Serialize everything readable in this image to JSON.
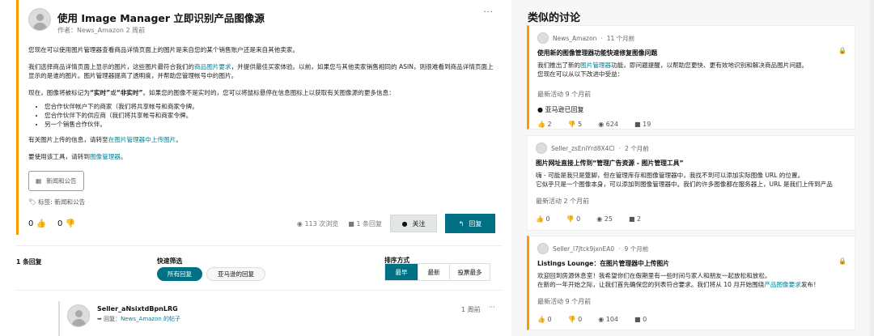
{
  "post": {
    "title": "使用 Image Manager 立即识别产品图像源",
    "meta": "作者：News_Amazon 2 周前",
    "more": "···",
    "p1": "您现在可以使用图片管理器查看商品详情页面上的图片是来自您的某个销售账户还是来自其他卖家。",
    "p2a": "我们选择商品详情页面上显示的图片，这些图片最符合我们的",
    "p2link": "商品图片要求",
    "p2b": "，并提供最佳买家体验。以前，如果您与其他卖家销售相同的 ASIN，则很难看到商品详情页面上显示的是谁的图片。图片管理器提高了透明度，并帮助您管理帐号中的图片。",
    "p3a": "现在，图像将被标记为",
    "p3b1": "“实时”",
    "p3c": "或",
    "p3b2": "“非实时”",
    "p3d": "。如果您的图像不是实时的，您可以将鼠标悬停在信息图标上以获取有关图像源的更多信息：",
    "bullets": [
      "您合作伙伴帐户下的商家（我们将共享帐号和商家令牌。",
      "您合作伙伴下的供应商（我们将共享帐号和商家令牌。",
      "另一个销售合作伙伴。"
    ],
    "p4a": "有关图片上传的信息，请转至",
    "p4link": "在图片管理器中上传图片",
    "p4b": "。",
    "p5a": "要使用该工具，请转到",
    "p5link": "图像管理器",
    "p5b": "。",
    "category": "新闻和公告",
    "tags": "标签: 新闻和公告",
    "upvotes": "0",
    "downvotes": "0",
    "views": "113 次浏览",
    "replies": "1 条回复",
    "follow": "关注",
    "reply": "回复"
  },
  "replies_section": {
    "count": "1 条回复",
    "filter_label": "快速筛选",
    "filter_all": "所有回复",
    "filter_amazon": "亚马逊的回复",
    "sort_label": "排序方式",
    "sort": [
      "最早",
      "最新",
      "投票最多"
    ]
  },
  "reply": {
    "author": "Seller_aNsixtdBpnLRG",
    "reply_to_prefix": "回复：",
    "reply_to": "News_Amazon 的帖子",
    "time": "1 周前",
    "more": "···"
  },
  "similar": {
    "title": "类似的讨论",
    "cards": [
      {
        "author": "News_Amazon",
        "time": "11 个月前",
        "title": "使用新的图像管理器功能快速修复图像问题",
        "text_a": "我们推出了新的",
        "link": "图片管理器",
        "text_b": "功能，即问题提醒，以帮助您更快、更有效地识别和解决商品图片问题。",
        "text2": "您现在可以从以下改进中受益：",
        "last": "最新活动 9 个月前",
        "badge": "亚马逊已回复",
        "up": "2",
        "down": "5",
        "views": "624",
        "comments": "19"
      },
      {
        "author": "Seller_zsEniYrd8X4Cl",
        "time": "2 个月前",
        "title": "图片网址直接上传到“管理广告资源 - 图片管理工具”",
        "text_a": "嗨 - 可能是我只是蹩脚，但在管理库存和图像管理器中，我找不到可以添加实际图像 URL 的位置。",
        "text2": "它似乎只是一个图像本身，可以添加到图像管理器中。我们的许多图像都在服务器上，URL 是我们上传到产品",
        "last": "最新活动 2 个月前",
        "up": "0",
        "down": "0",
        "views": "25",
        "comments": "2"
      },
      {
        "author": "Seller_l7Jtck9jxnEA0",
        "time": "9 个月前",
        "title": "Listings Lounge：在图片管理器中上传图片",
        "text_a": "欢迎回到房源休息室！我希望你们在假期里有一些时间与家人和朋友一起放松和放松。",
        "text2a": "在新的一年开始之际，让我们首先确保您的列表符合要求。我们将从 10 月开始围绕",
        "link": "产品图像要求",
        "text2b": "发布！",
        "last": "最新活动 9 个月前",
        "up": "0",
        "down": "0",
        "views": "104",
        "comments": "0"
      }
    ]
  }
}
